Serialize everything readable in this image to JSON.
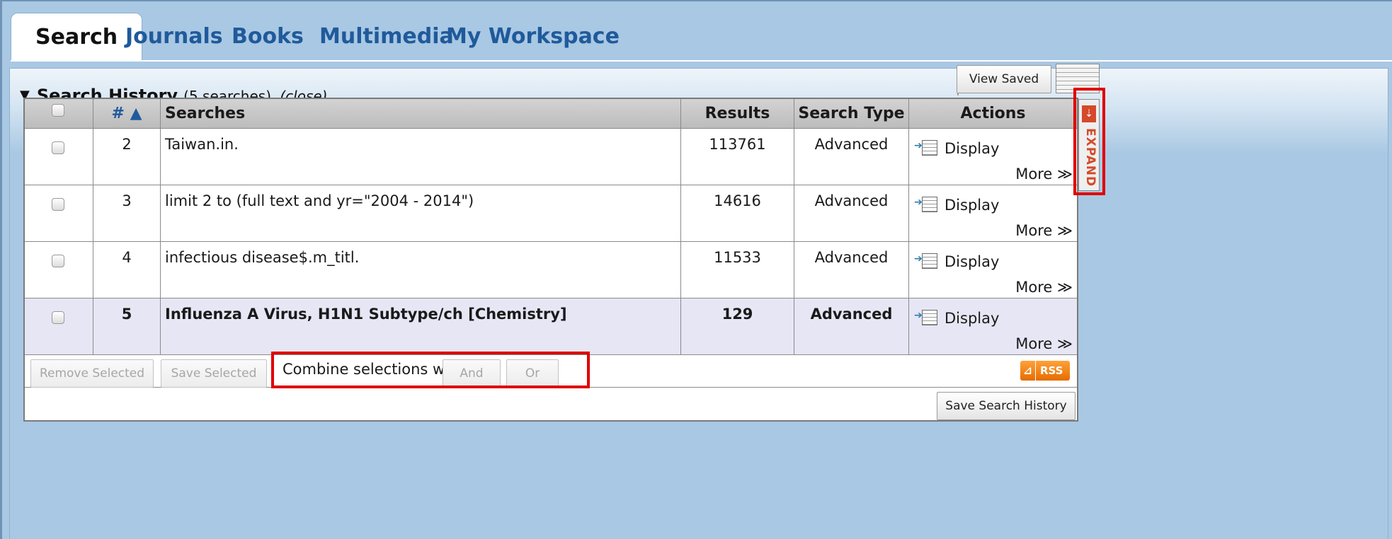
{
  "tabs": [
    "Search",
    "Journals",
    "Books",
    "Multimedia",
    "My Workspace"
  ],
  "history": {
    "title": "Search History",
    "count": "(5 searches)",
    "close": "(close)",
    "view_saved": "View Saved"
  },
  "table": {
    "headers": {
      "number": "# ▲",
      "searches": "Searches",
      "results": "Results",
      "search_type": "Search Type",
      "actions": "Actions"
    },
    "rows": [
      {
        "num": "2",
        "query": "Taiwan.in.",
        "results": "113761",
        "type": "Advanced",
        "display": "Display",
        "more": "More ≫"
      },
      {
        "num": "3",
        "query": "limit 2 to (full text and yr=\"2004 - 2014\")",
        "results": "14616",
        "type": "Advanced",
        "display": "Display",
        "more": "More ≫"
      },
      {
        "num": "4",
        "query": "infectious disease$.m_titl.",
        "results": "11533",
        "type": "Advanced",
        "display": "Display",
        "more": "More ≫"
      },
      {
        "num": "5",
        "query": "Influenza A Virus, H1N1 Subtype/ch [Chemistry]",
        "results": "129",
        "type": "Advanced",
        "display": "Display",
        "more": "More ≫"
      }
    ]
  },
  "footer": {
    "remove_selected": "Remove Selected",
    "save_selected": "Save Selected",
    "combine_label": "Combine selections with:",
    "and": "And",
    "or": "Or",
    "rss": "RSS",
    "save_history": "Save Search History"
  },
  "expand": {
    "label": "EXPAND",
    "icon": "⇣"
  },
  "icons": {
    "triangle": "▼",
    "rss_icon": "⊿"
  },
  "colors": {
    "tab_link": "#1f5a9b",
    "background": "#a9c8e3",
    "highlight_border": "#e00000",
    "expand_accent": "#d44a2a"
  }
}
